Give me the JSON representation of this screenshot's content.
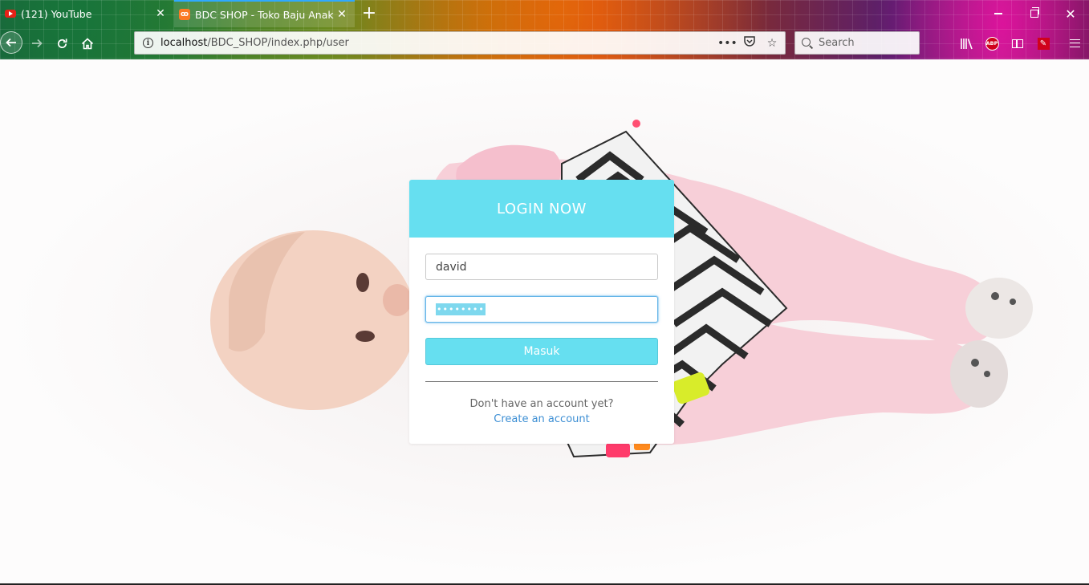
{
  "browser": {
    "tabs": [
      {
        "title": "(121) YouTube",
        "icon": "youtube-icon",
        "active": false
      },
      {
        "title": "BDC SHOP - Toko Baju Anak",
        "icon": "xampp-icon",
        "active": true
      }
    ],
    "new_tab_label": "+",
    "url_host": "localhost",
    "url_path": "/BDC_SHOP/index.php/user",
    "search_placeholder": "Search",
    "abp_label": "ABP"
  },
  "login": {
    "header": "LOGIN NOW",
    "username_value": "david",
    "password_mask": "••••••••",
    "submit_label": "Masuk",
    "no_account_text": "Don't have an account yet?",
    "create_account_link": "Create an account"
  },
  "colors": {
    "accent": "#66dff0",
    "link": "#3d8fd4"
  }
}
